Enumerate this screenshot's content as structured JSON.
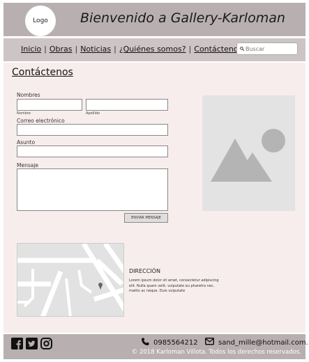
{
  "header": {
    "logo_text": "Logo",
    "title": "Bienvenido a Gallery-Karloman"
  },
  "nav": {
    "items": [
      {
        "label": "Inicio"
      },
      {
        "label": "Obras"
      },
      {
        "label": "Noticias"
      },
      {
        "label": "¿Quiénes somos?"
      },
      {
        "label": "Contáctenos"
      }
    ],
    "search_placeholder": "Buscar",
    "search_icon": "search-icon"
  },
  "page": {
    "title": "Contáctenos"
  },
  "form": {
    "names_label": "Nombres",
    "first_name_sublabel": "Nombre",
    "last_name_sublabel": "Apellido",
    "email_label": "Correo electrónico",
    "subject_label": "Asunto",
    "message_label": "Mensaje",
    "send_button": "ENVIAR MENSAJE"
  },
  "address": {
    "title": "DIRECCIÓN",
    "text": "Lorem ipsum dolor sit amet, consectetur adipiscing elit. Nulla quam velit, vulputate eu pharetra nec, mattis ac neque. Duis vulputate"
  },
  "footer": {
    "social": [
      "facebook-icon",
      "twitter-icon",
      "instagram-icon"
    ],
    "phone": "0985564212",
    "email": "sand_mille@hotmail.com.",
    "copyright": "© 2018 Karloman Villota. Todos los derechos reservados."
  }
}
